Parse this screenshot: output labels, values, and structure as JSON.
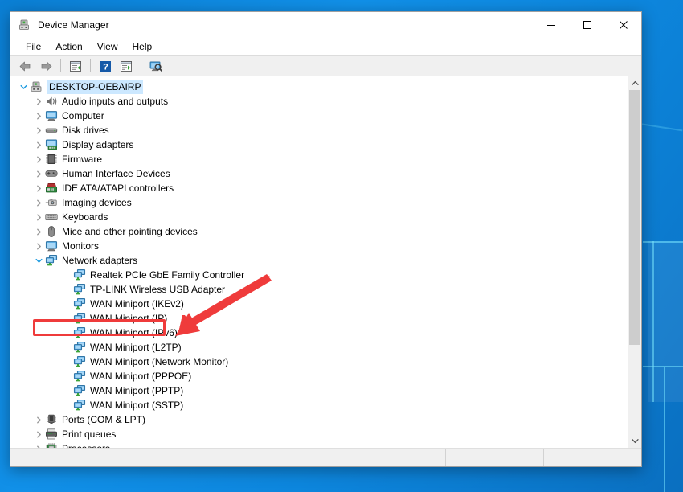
{
  "window": {
    "title": "Device Manager",
    "icon": "device-manager-icon",
    "controls": {
      "minimize": "–",
      "maximize": "□",
      "close": "✕"
    }
  },
  "menubar": {
    "items": [
      {
        "label": "File",
        "name": "menu-file"
      },
      {
        "label": "Action",
        "name": "menu-action"
      },
      {
        "label": "View",
        "name": "menu-view"
      },
      {
        "label": "Help",
        "name": "menu-help"
      }
    ]
  },
  "toolbar": {
    "buttons": [
      {
        "name": "back-icon",
        "title": "Back"
      },
      {
        "name": "forward-icon",
        "title": "Forward"
      },
      {
        "name": "properties-icon",
        "title": "Properties"
      },
      {
        "name": "help-icon",
        "title": "Help"
      },
      {
        "name": "update-driver-icon",
        "title": "Update driver"
      },
      {
        "name": "scan-hardware-changes-icon",
        "title": "Scan for hardware changes"
      }
    ]
  },
  "tree": {
    "root": {
      "label": "DESKTOP-OEBAIRP",
      "icon": "computer-root-icon",
      "expanded": true,
      "selected": true
    },
    "categories": [
      {
        "label": "Audio inputs and outputs",
        "icon": "speaker-icon",
        "expanded": false
      },
      {
        "label": "Computer",
        "icon": "monitor-icon",
        "expanded": false
      },
      {
        "label": "Disk drives",
        "icon": "disk-icon",
        "expanded": false
      },
      {
        "label": "Display adapters",
        "icon": "display-adapter-icon",
        "expanded": false
      },
      {
        "label": "Firmware",
        "icon": "chip-icon",
        "expanded": false
      },
      {
        "label": "Human Interface Devices",
        "icon": "gamepad-icon",
        "expanded": false
      },
      {
        "label": "IDE ATA/ATAPI controllers",
        "icon": "ide-controller-icon",
        "expanded": false
      },
      {
        "label": "Imaging devices",
        "icon": "camera-icon",
        "expanded": false
      },
      {
        "label": "Keyboards",
        "icon": "keyboard-icon",
        "expanded": false
      },
      {
        "label": "Mice and other pointing devices",
        "icon": "mouse-icon",
        "expanded": false
      },
      {
        "label": "Monitors",
        "icon": "monitor-icon",
        "expanded": false
      },
      {
        "label": "Network adapters",
        "icon": "network-adapter-icon",
        "expanded": true,
        "highlighted": true
      },
      {
        "label": "Ports (COM & LPT)",
        "icon": "port-icon",
        "expanded": false
      },
      {
        "label": "Print queues",
        "icon": "printer-icon",
        "expanded": false
      },
      {
        "label": "Processors",
        "icon": "processor-icon",
        "expanded": false
      }
    ],
    "network_adapters": [
      {
        "label": "Realtek PCIe GbE Family Controller",
        "icon": "network-adapter-icon"
      },
      {
        "label": "TP-LINK Wireless USB Adapter",
        "icon": "network-adapter-icon"
      },
      {
        "label": "WAN Miniport (IKEv2)",
        "icon": "network-adapter-icon"
      },
      {
        "label": "WAN Miniport (IP)",
        "icon": "network-adapter-icon"
      },
      {
        "label": "WAN Miniport (IPv6)",
        "icon": "network-adapter-icon"
      },
      {
        "label": "WAN Miniport (L2TP)",
        "icon": "network-adapter-icon"
      },
      {
        "label": "WAN Miniport (Network Monitor)",
        "icon": "network-adapter-icon"
      },
      {
        "label": "WAN Miniport (PPPOE)",
        "icon": "network-adapter-icon"
      },
      {
        "label": "WAN Miniport (PPTP)",
        "icon": "network-adapter-icon"
      },
      {
        "label": "WAN Miniport (SSTP)",
        "icon": "network-adapter-icon"
      }
    ]
  },
  "statusbar": {
    "main": "",
    "pane1": "",
    "pane2": ""
  },
  "annotations": {
    "highlight_rect_target": "Network adapters",
    "arrow_target": "Network adapters",
    "color": "#ef3b3b"
  },
  "colors": {
    "selection": "#cce8ff",
    "annotation_red": "#ef3b3b",
    "desktop_blue": "#0d86dd",
    "toolbar_bg": "#f0f0f0"
  }
}
